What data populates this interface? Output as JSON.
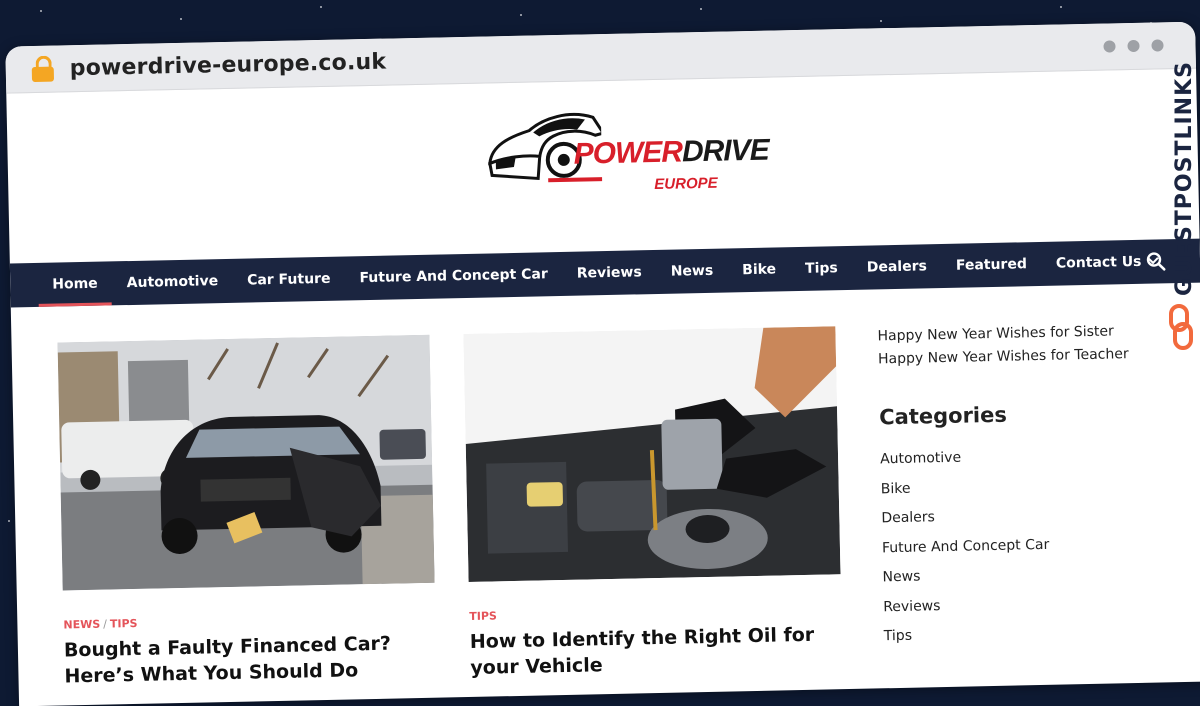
{
  "browser": {
    "url": "powerdrive-europe.co.uk"
  },
  "logo": {
    "word1": "POWER",
    "word2": "DRIVE",
    "word3": "EUROPE"
  },
  "nav": {
    "items": [
      {
        "label": "Home"
      },
      {
        "label": "Automotive"
      },
      {
        "label": "Car Future"
      },
      {
        "label": "Future And Concept Car"
      },
      {
        "label": "Reviews"
      },
      {
        "label": "News"
      },
      {
        "label": "Bike"
      },
      {
        "label": "Tips"
      },
      {
        "label": "Dealers"
      },
      {
        "label": "Featured"
      },
      {
        "label": "Contact Us"
      }
    ]
  },
  "posts": [
    {
      "categories": [
        "NEWS",
        "TIPS"
      ],
      "title": "Bought a Faulty Financed Car? Here’s What You Should Do"
    },
    {
      "categories": [
        "TIPS"
      ],
      "title": "How to Identify the Right Oil for your Vehicle"
    }
  ],
  "sidebar": {
    "recent": [
      "Happy New Year Wishes for Sister",
      "Happy New Year Wishes for Teacher"
    ],
    "categories_title": "Categories",
    "categories": [
      "Automotive",
      "Bike",
      "Dealers",
      "Future And Concept Car",
      "News",
      "Reviews",
      "Tips"
    ]
  },
  "watermark": {
    "text": "GUESTPOSTLINKS"
  },
  "colors": {
    "nav_bg": "#1b2540",
    "accent": "#e4545a",
    "logo_red": "#d81f2a",
    "lock": "#f4a623"
  }
}
